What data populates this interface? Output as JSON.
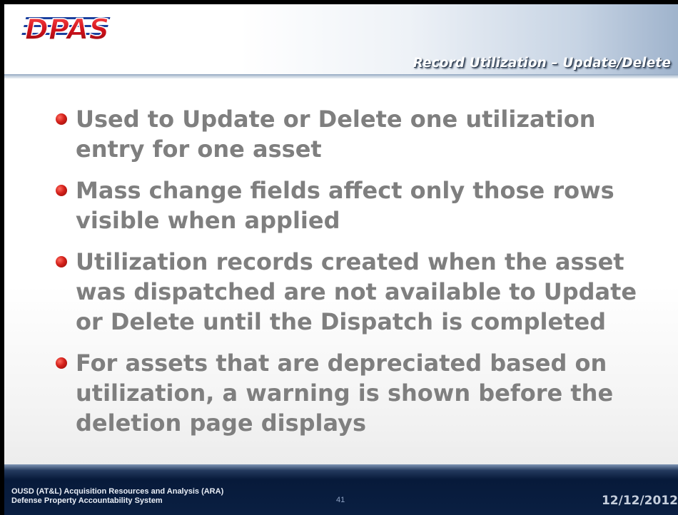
{
  "header": {
    "logo_text": "DPAS",
    "title": "Record Utilization – Update/Delete"
  },
  "bullets": [
    {
      "text": "Used to Update or Delete one utilization entry for one asset"
    },
    {
      "text": "Mass change fields affect only those rows visible when applied"
    },
    {
      "text": "Utilization records created when the asset was dispatched are not available to Update or Delete until the Dispatch is completed"
    },
    {
      "text": "For assets that are depreciated based on utilization, a warning is shown before the deletion page displays"
    }
  ],
  "footer": {
    "line1": "OUSD (AT&L) Acquisition Resources and Analysis (ARA)",
    "line2": "Defense Property Accountability System",
    "page_number": "41",
    "date": "12/12/2012"
  },
  "colors": {
    "bullet_text": "#7f7f7f",
    "bullet_dot": "#d3201a",
    "logo_red": "#c8141e",
    "footer_bg": "#0a1f42"
  }
}
